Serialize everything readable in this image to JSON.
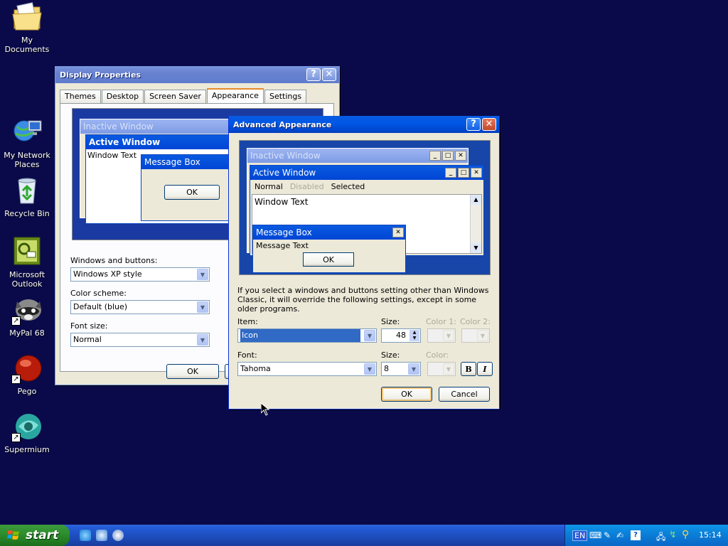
{
  "desktop": {
    "icons": [
      {
        "label": "My Documents"
      },
      {
        "label": "My Network Places"
      },
      {
        "label": "Recycle Bin"
      },
      {
        "label": "Microsoft Outlook"
      },
      {
        "label": "MyPal 68"
      },
      {
        "label": "Pego"
      },
      {
        "label": "Supermium"
      }
    ]
  },
  "display_props": {
    "title": "Display Properties",
    "help_glyph": "?",
    "close_glyph": "✕",
    "tabs": [
      "Themes",
      "Desktop",
      "Screen Saver",
      "Appearance",
      "Settings"
    ],
    "selected_tab": "Appearance",
    "preview": {
      "inactive_title": "Inactive Window",
      "active_title": "Active Window",
      "window_text": "Window Text",
      "message_title": "Message Box",
      "ok": "OK"
    },
    "windows_buttons_label": "Windows and buttons:",
    "windows_buttons_value": "Windows XP style",
    "color_scheme_label": "Color scheme:",
    "color_scheme_value": "Default (blue)",
    "font_size_label": "Font size:",
    "font_size_value": "Normal",
    "ok": "OK"
  },
  "advanced": {
    "title": "Advanced Appearance",
    "help_glyph": "?",
    "close_glyph": "✕",
    "preview": {
      "inactive_title": "Inactive Window",
      "active_title": "Active Window",
      "menu_normal": "Normal",
      "menu_disabled": "Disabled",
      "menu_selected": "Selected",
      "window_text": "Window Text",
      "message_title": "Message Box",
      "message_text": "Message Text",
      "ok": "OK"
    },
    "note": "If you select a windows and buttons setting other than Windows Classic, it will override the following settings, except in some older programs.",
    "item_label": "Item:",
    "item_value": "Icon",
    "size_label": "Size:",
    "size_value": "48",
    "color1_label": "Color 1:",
    "color2_label": "Color 2:",
    "font_label": "Font:",
    "font_value": "Tahoma",
    "font_size_label": "Size:",
    "font_size_value": "8",
    "color_label": "Color:",
    "bold": "B",
    "italic": "I",
    "ok": "OK",
    "cancel": "Cancel"
  },
  "taskbar": {
    "start": "start",
    "language": "EN",
    "clock": "15:14"
  }
}
